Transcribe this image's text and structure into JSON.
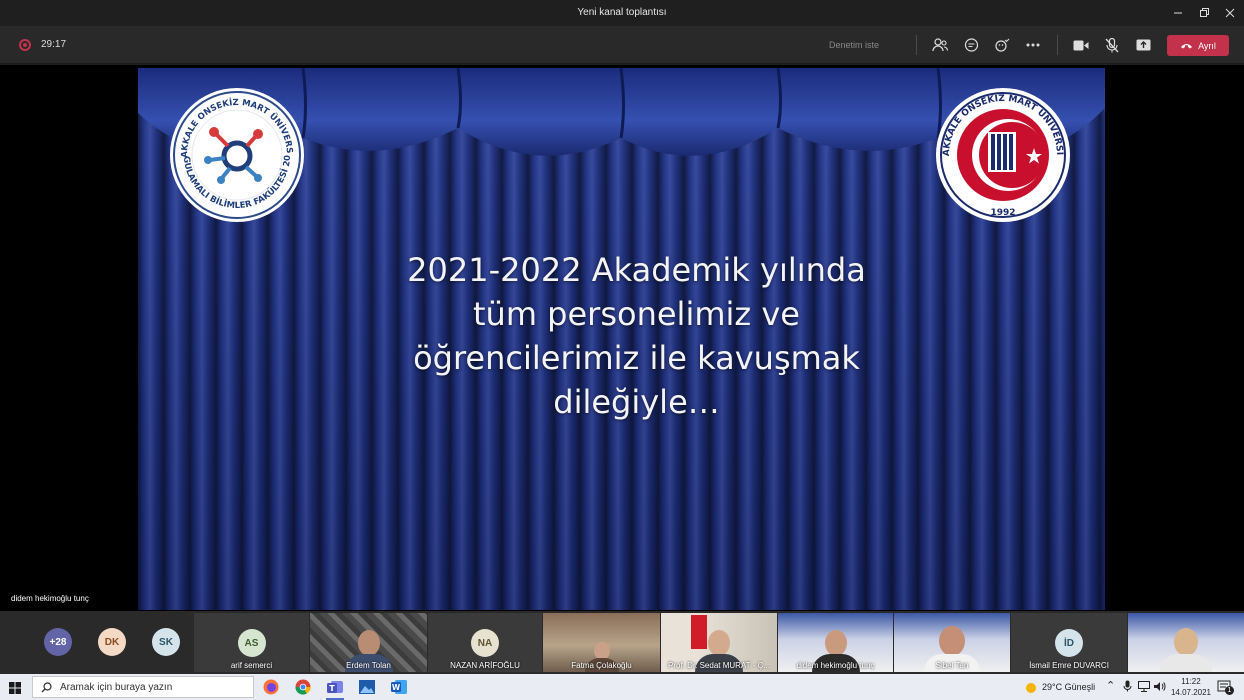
{
  "window": {
    "title": "Yeni kanal toplantısı"
  },
  "toolbar": {
    "timer": "29:17",
    "raise_hand_label": "Denetim iste",
    "leave_label": "Ayrıl"
  },
  "slide": {
    "lines": [
      "2021-2022 Akademik yılında",
      "tüm personelimiz ve",
      "öğrencilerimiz ile kavuşmak",
      "dileğiyle…"
    ],
    "logo_left_text_top": "ÇANAKKALE ONSEKİZ MART ÜNİVERSİTESİ",
    "logo_left_text_bottom": "UYGULAMALI BİLİMLER FAKÜLTESİ 2020",
    "logo_right_text": "ÇANAKKALE ONSEKİZ MART ÜNİVERSİTESİ",
    "logo_right_year": "1992"
  },
  "presenter": {
    "name": "didem hekimoğlu tunç"
  },
  "participants": {
    "overflow_count": "+28",
    "avatars": [
      {
        "initials": "DK",
        "color": "#f4d9c4",
        "text_color": "#8a4b20"
      },
      {
        "initials": "SK",
        "color": "#d4e4ea",
        "text_color": "#2d5566"
      }
    ],
    "tiles": [
      {
        "name": "arif semerci",
        "initials": "AS",
        "kind": "avatar",
        "color": "#d6e5cf",
        "text_color": "#3b5c2c"
      },
      {
        "name": "Erdem Tolan",
        "kind": "video"
      },
      {
        "name": "NAZAN ARİFOĞLU",
        "initials": "NA",
        "kind": "avatar",
        "color": "#e7e1cf",
        "text_color": "#5e5430"
      },
      {
        "name": "Fatma Çolakoğlu",
        "kind": "video"
      },
      {
        "name": "Prof. Dr. Sedat MURAT - Ç...",
        "kind": "video"
      },
      {
        "name": "didem hekimoğlu tunç",
        "kind": "video"
      },
      {
        "name": "Sibel Tan",
        "kind": "video"
      },
      {
        "name": "İsmail Emre DUVARCI",
        "initials": "İD",
        "kind": "avatar",
        "color": "#d4e4ea",
        "text_color": "#2d5566"
      },
      {
        "name": "",
        "kind": "video"
      }
    ]
  },
  "taskbar": {
    "search_placeholder": "Aramak için buraya yazın",
    "weather": "29°C  Güneşli",
    "time": "11:22",
    "date": "14.07.2021",
    "notification_count": "1"
  },
  "colors": {
    "leave_red": "#c4314b",
    "overflow_purple": "#6264a7",
    "curtain_blue": "#22358a"
  }
}
